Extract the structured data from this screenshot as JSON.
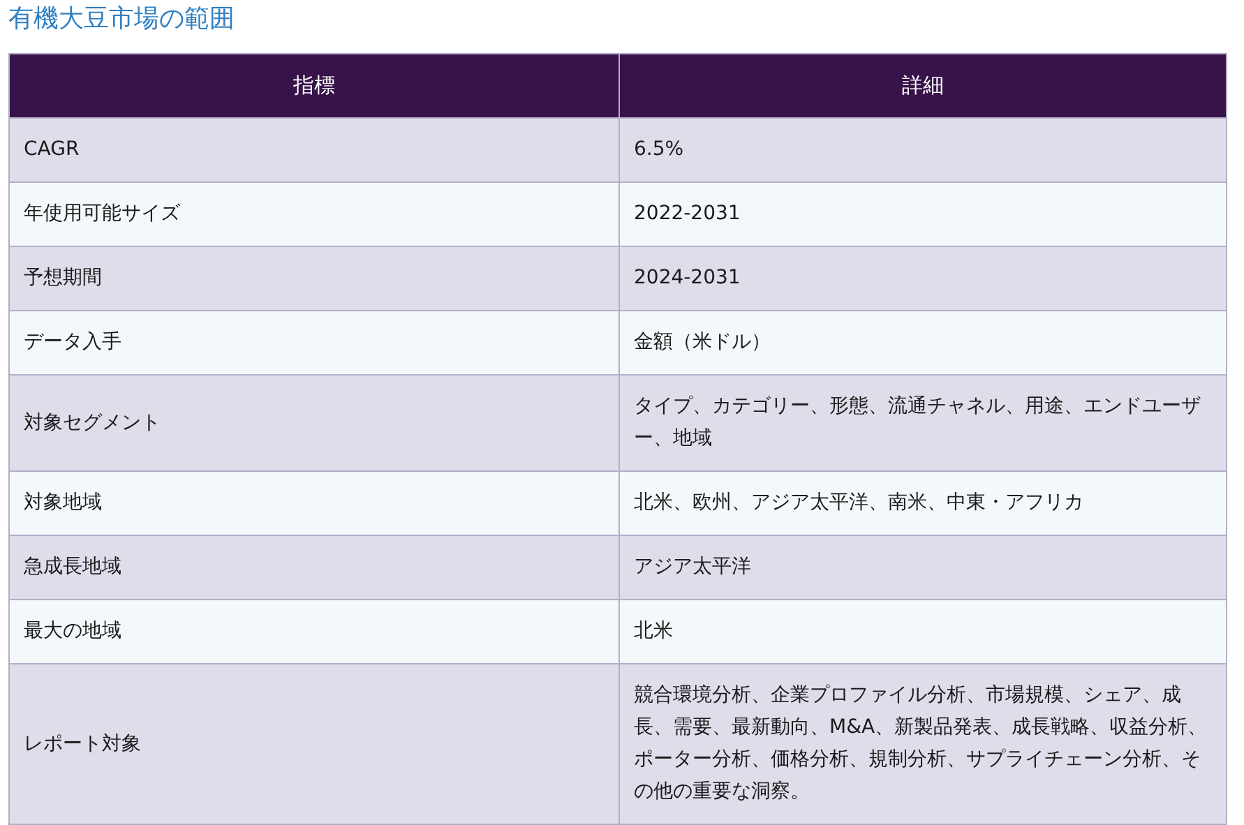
{
  "title": "有機大豆市場の範囲",
  "table": {
    "columns": [
      "指標",
      "詳細"
    ],
    "rows": [
      [
        "CAGR",
        "6.5%"
      ],
      [
        "年使用可能サイズ",
        "2022-2031"
      ],
      [
        "予想期間",
        "2024-2031"
      ],
      [
        "データ入手",
        "金額（米ドル）"
      ],
      [
        "対象セグメント",
        "タイプ、カテゴリー、形態、流通チャネル、用途、エンドユーザー、地域"
      ],
      [
        "対象地域",
        "北米、欧州、アジア太平洋、南米、中東・アフリカ"
      ],
      [
        "急成長地域",
        "アジア太平洋"
      ],
      [
        "最大の地域",
        "北米"
      ],
      [
        "レポート対象",
        "競合環境分析、企業プロファイル分析、市場規模、シェア、成長、需要、最新動向、M&A、新製品発表、成長戦略、収益分析、ポーター分析、価格分析、規制分析、サプライチェーン分析、その他の重要な洞察。"
      ]
    ]
  }
}
